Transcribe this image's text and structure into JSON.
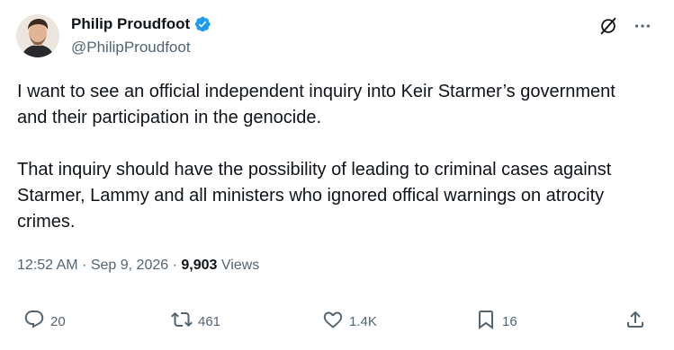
{
  "author": {
    "display_name": "Philip Proudfoot",
    "handle": "@PhilipProudfoot",
    "verified": true
  },
  "tweet": {
    "paragraphs": [
      "I want to see an official independent inquiry into Keir Starmer’s government and their participation in the genocide.",
      "That inquiry should have the possibility of leading to criminal cases against Starmer, Lammy and all ministers who ignored offical warnings on atrocity crimes."
    ],
    "time": "12:52 AM",
    "date": "Sep 9, 2026",
    "separator": "·",
    "views_count": "9,903",
    "views_label": "Views"
  },
  "actions": {
    "replies": "20",
    "reposts": "461",
    "likes": "1.4K",
    "bookmarks": "16"
  },
  "colors": {
    "verified_blue": "#1d9bf0",
    "secondary_text": "#536471",
    "primary_text": "#0f1419"
  },
  "icons": [
    "verified-badge-icon",
    "grok-icon",
    "more-icon",
    "reply-icon",
    "repost-icon",
    "like-icon",
    "bookmark-icon",
    "share-icon"
  ]
}
